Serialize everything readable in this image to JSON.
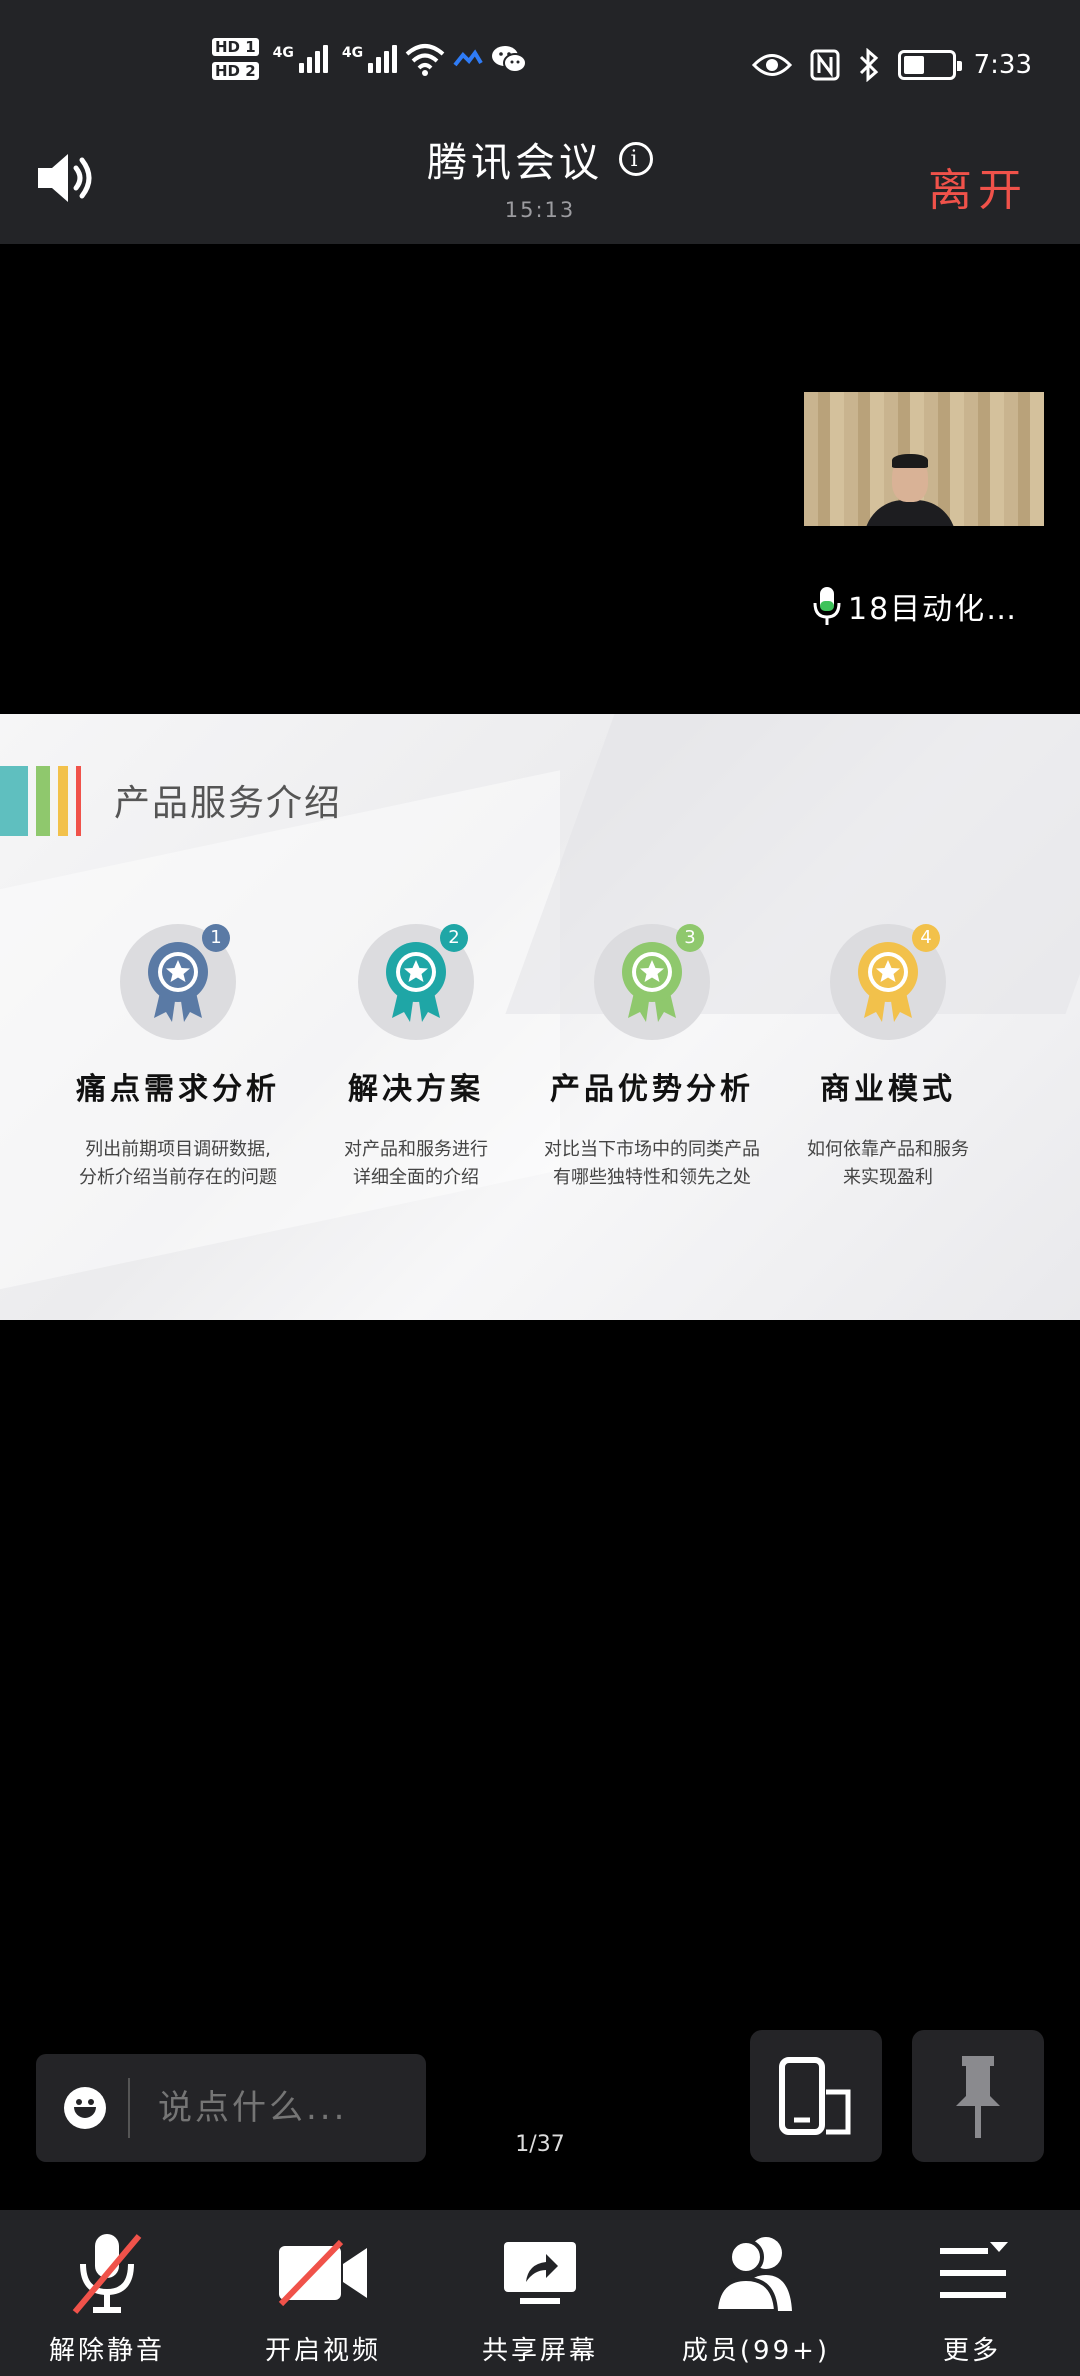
{
  "status_bar": {
    "sim1": "HD 1",
    "sim2": "HD 2",
    "network1": "4G",
    "network2": "4G",
    "time": "7:33",
    "battery_level": 0.45
  },
  "meeting": {
    "title": "腾讯会议",
    "duration": "15:13",
    "leave_label": "离开"
  },
  "participant": {
    "label": "18目动化…"
  },
  "slide": {
    "title": "产品服务介绍",
    "accent_colors": [
      "#5fbfbf",
      "#8fc86d",
      "#f2c14b",
      "#f0524a"
    ],
    "items": [
      {
        "num": "1",
        "title": "痛点需求分析",
        "desc1": "列出前期项目调研数据,",
        "desc2": "分析介绍当前存在的问题",
        "color": "#5a7aa5"
      },
      {
        "num": "2",
        "title": "解决方案",
        "desc1": "对产品和服务进行",
        "desc2": "详细全面的介绍",
        "color": "#1fa6a6"
      },
      {
        "num": "3",
        "title": "产品优势分析",
        "desc1": "对比当下市场中的同类产品",
        "desc2": "有哪些独特性和领先之处",
        "color": "#8fc86d"
      },
      {
        "num": "4",
        "title": "商业模式",
        "desc1": "如何依靠产品和服务",
        "desc2": "来实现盈利",
        "color": "#f2c14b"
      }
    ]
  },
  "chat": {
    "placeholder": "说点什么..."
  },
  "page_indicator": "1/37",
  "toolbar": {
    "unmute": "解除静音",
    "start_video": "开启视频",
    "share_screen": "共享屏幕",
    "members": "成员(99+)",
    "more": "更多"
  }
}
